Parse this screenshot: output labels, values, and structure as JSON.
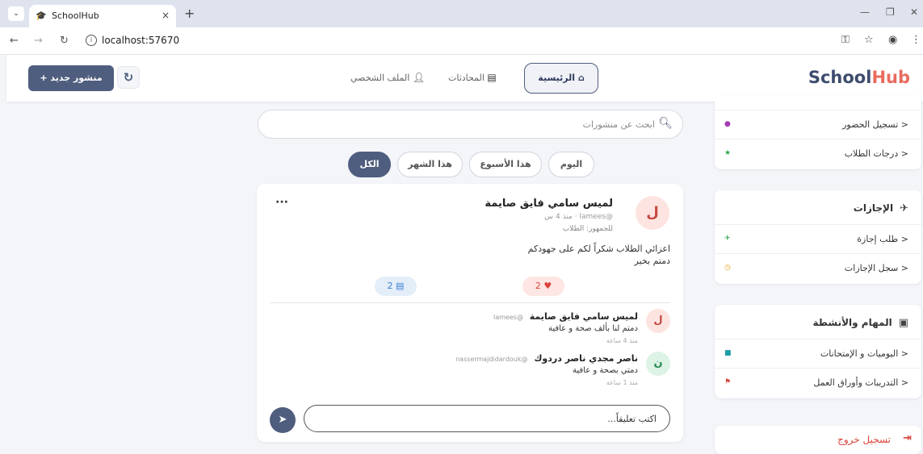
{
  "browser": {
    "tab_title": "SchoolHub",
    "url": "localhost:57670",
    "tab_close": "×",
    "new_tab": "+",
    "tab_menu": "⌄"
  },
  "header": {
    "logo_main": "School",
    "logo_accent": "Hub",
    "new_post_label": "+  منشور جديد",
    "refresh_icon": "↻",
    "nav": {
      "home": "الرئيسية",
      "chats": "المحادثات",
      "profile": "الملف الشخصي"
    }
  },
  "feed": {
    "search_placeholder": "ابحث عن منشورات",
    "filters": {
      "all": "الكل",
      "month": "هذا الشهر",
      "week": "هذا الأسبوع",
      "today": "اليوم"
    },
    "post": {
      "avatar_letter": "ل",
      "author": "لميس سامي فايق صايمة",
      "meta": "@lamees · منذ 4 س",
      "audience": "للجمهور: الطلاب",
      "text_line1": "اعزائي الطلاب شكراً لكم على جهودكم",
      "text_line2": "دمتم بخير",
      "likes": "2",
      "comments": "2",
      "more": "···",
      "comment_list": [
        {
          "avatar": "ل",
          "name": "لميس سامي فايق صايمة",
          "handle": "@lamees",
          "text": "دمتم لنا بألف صحة و عافية",
          "time": "منذ 4 ساعة"
        },
        {
          "avatar": "ن",
          "name": "ناصر مجدي ناصر دردوك",
          "handle": "@nassermajdidardouk",
          "text": "دمتي بصحة و عافية",
          "time": "منذ 1 ساعة"
        }
      ],
      "comment_placeholder": "اكتب تعليقاً..."
    }
  },
  "sidebar": {
    "group1_items": [
      {
        "label": "تسجيل الحضور",
        "dot_color": "#a23bb0"
      },
      {
        "label": "درجات الطلاب",
        "dot_color": "#2ea84a"
      }
    ],
    "leaves": {
      "title": "الإجازات",
      "items": [
        {
          "label": "طلب إجازة",
          "dot_color": "#2ea84a"
        },
        {
          "label": "سجل الإجازات",
          "dot_color": "#e0a41c"
        }
      ]
    },
    "tasks": {
      "title": "المهام والأنشطة",
      "items": [
        {
          "label": "اليوميات و الإمتحانات",
          "dot_color": "#1f9aa8"
        },
        {
          "label": "التدريبات وأوراق العمل",
          "dot_color": "#d9433a"
        }
      ]
    },
    "logout": "تسجيل خروج"
  }
}
